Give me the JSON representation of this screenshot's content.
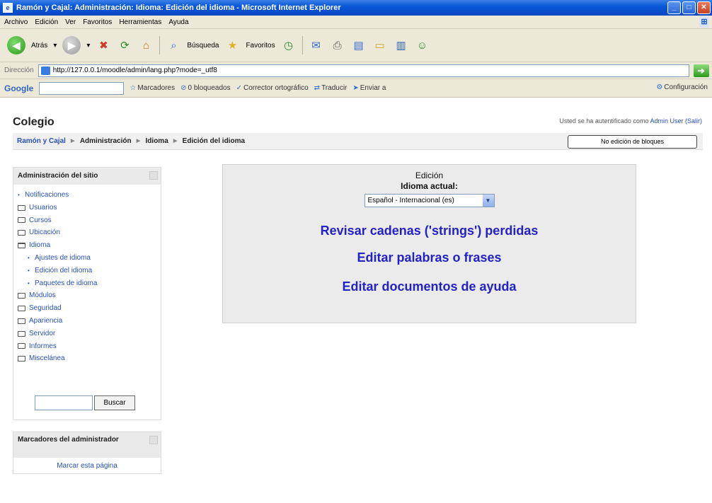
{
  "window": {
    "title": "Ramón y Cajal: Administración: Idioma: Edición del idioma - Microsoft Internet Explorer"
  },
  "menubar": [
    "Archivo",
    "Edición",
    "Ver",
    "Favoritos",
    "Herramientas",
    "Ayuda"
  ],
  "toolbar": {
    "back_label": "Atrás",
    "search_label": "Búsqueda",
    "favorites_label": "Favoritos"
  },
  "address": {
    "label": "Dirección",
    "url": "http://127.0.0.1/moodle/admin/lang.php?mode=_utf8"
  },
  "googlebar": {
    "logo": "Google",
    "items": [
      "Marcadores",
      "0 bloqueados",
      "Corrector ortográfico",
      "Traducir",
      "Enviar a"
    ],
    "config": "Configuración"
  },
  "header": {
    "site_name": "Colegio",
    "login_prefix": "Usted se ha autentificado como ",
    "login_user": "Admin User",
    "logout": "(Salir)"
  },
  "breadcrumb": {
    "items": [
      "Ramón y Cajal",
      "Administración",
      "Idioma",
      "Edición del idioma"
    ],
    "sep": "►",
    "edit_blocks_button": "No edición de bloques"
  },
  "admin_block": {
    "title": "Administración del sitio",
    "items": [
      {
        "label": "Notificaciones",
        "type": "leaf"
      },
      {
        "label": "Usuarios",
        "type": "folder"
      },
      {
        "label": "Cursos",
        "type": "folder"
      },
      {
        "label": "Ubicación",
        "type": "folder"
      },
      {
        "label": "Idioma",
        "type": "open"
      },
      {
        "label": "Ajustes de idioma",
        "type": "sub"
      },
      {
        "label": "Edición del idioma",
        "type": "sub"
      },
      {
        "label": "Paquetes de idioma",
        "type": "sub"
      },
      {
        "label": "Módulos",
        "type": "folder"
      },
      {
        "label": "Seguridad",
        "type": "folder"
      },
      {
        "label": "Apariencia",
        "type": "folder"
      },
      {
        "label": "Servidor",
        "type": "folder"
      },
      {
        "label": "Informes",
        "type": "folder"
      },
      {
        "label": "Miscelánea",
        "type": "folder"
      }
    ],
    "search_button": "Buscar"
  },
  "bookmarks_block": {
    "title": "Marcadores del administrador",
    "link": "Marcar esta página"
  },
  "main": {
    "title": "Edición",
    "language_label": "Idioma actual:",
    "language_selected": "Español - Internacional (es)",
    "links": [
      "Revisar cadenas ('strings') perdidas",
      "Editar palabras o frases",
      "Editar documentos de ayuda"
    ]
  }
}
